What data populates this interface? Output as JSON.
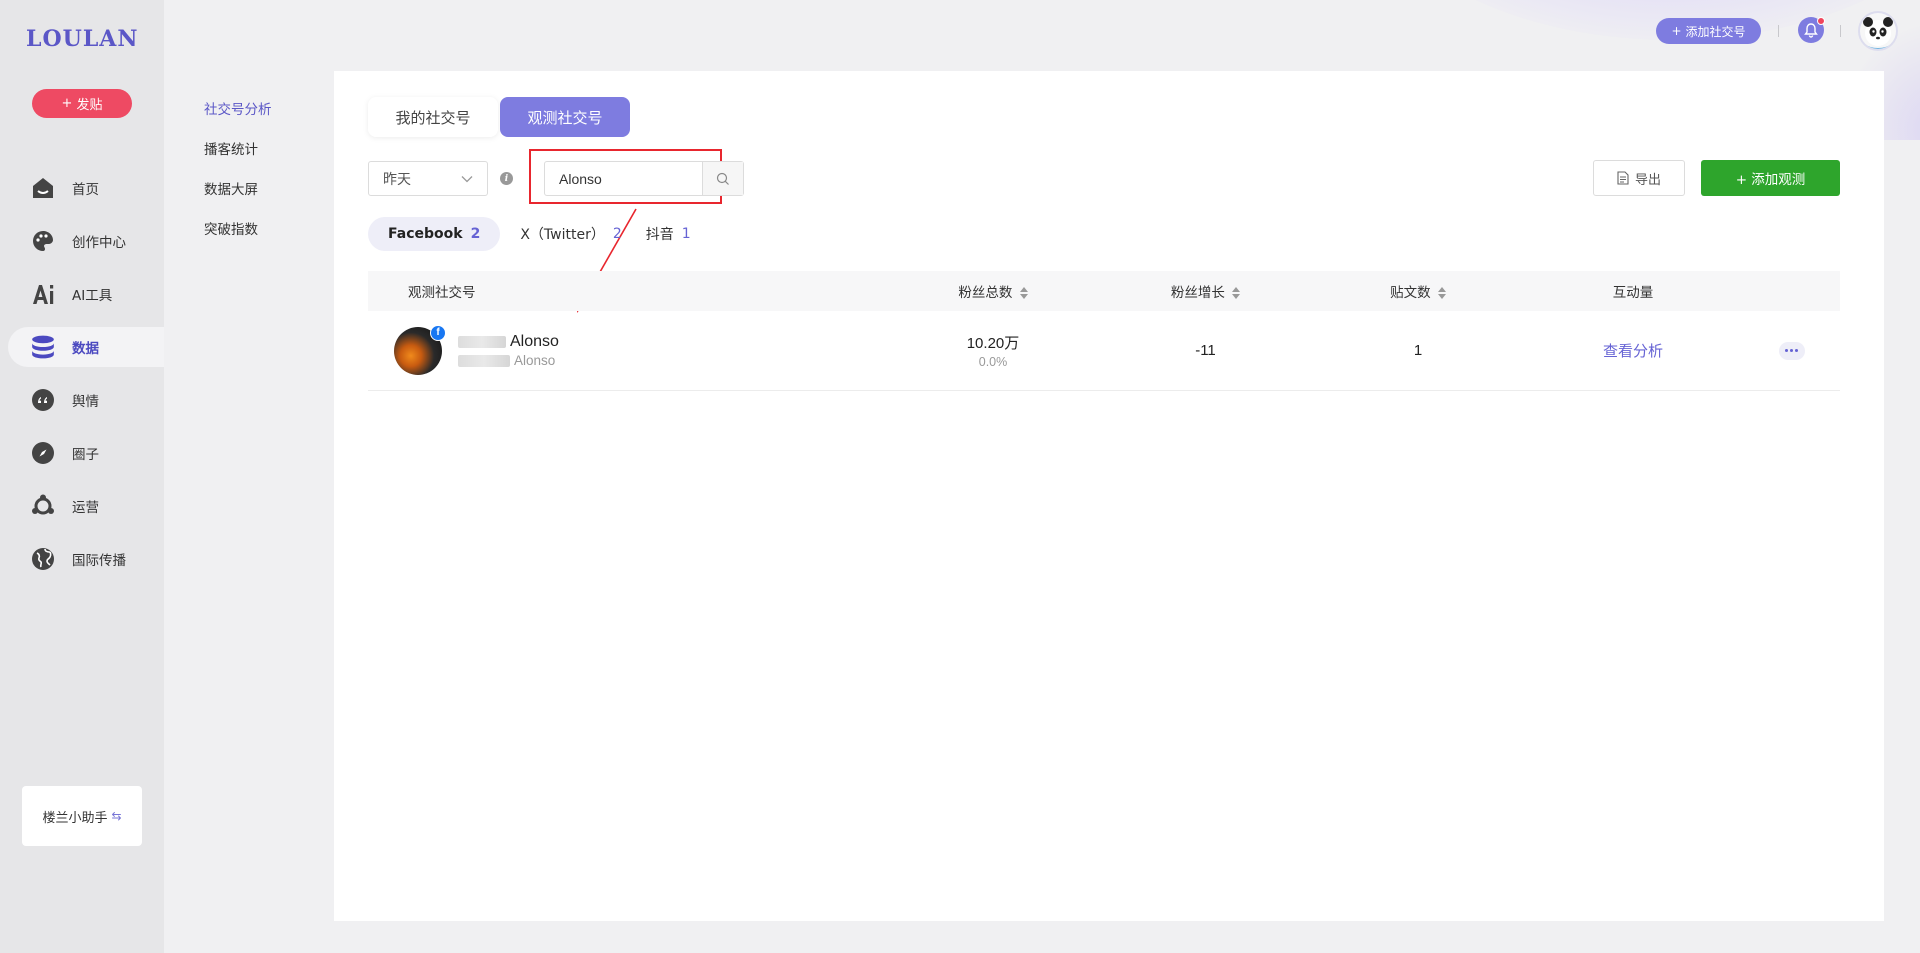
{
  "app": {
    "logo": "LOULAN",
    "post_button": "发贴"
  },
  "sidebar": {
    "items": [
      {
        "label": "首页",
        "icon": "home-icon"
      },
      {
        "label": "创作中心",
        "icon": "palette-icon"
      },
      {
        "label": "AI工具",
        "icon": "ai-icon"
      },
      {
        "label": "数据",
        "icon": "database-icon",
        "active": true
      },
      {
        "label": "舆情",
        "icon": "quote-icon"
      },
      {
        "label": "圈子",
        "icon": "compass-icon"
      },
      {
        "label": "运营",
        "icon": "network-icon"
      },
      {
        "label": "国际传播",
        "icon": "globe-icon"
      }
    ],
    "assistant": "楼兰小助手"
  },
  "subnav": {
    "items": [
      "社交号分析",
      "播客统计",
      "数据大屏",
      "突破指数"
    ],
    "active_index": 0
  },
  "header": {
    "add_account": "添加社交号"
  },
  "main": {
    "tabs": [
      "我的社交号",
      "观测社交号"
    ],
    "active_tab": 1,
    "date_select": "昨天",
    "search": {
      "value": "Alonso",
      "placeholder": ""
    },
    "export": "导出",
    "add_observe": "+ 添加观测",
    "platforms": [
      {
        "name": "Facebook",
        "count": "2",
        "active": true
      },
      {
        "name": "X（Twitter）",
        "count": "2"
      },
      {
        "name": "抖音",
        "count": "1"
      }
    ]
  },
  "table": {
    "headers": {
      "account": "观测社交号",
      "fans_total": "粉丝总数",
      "fans_growth": "粉丝增长",
      "posts": "贴文数",
      "interaction": "互动量"
    },
    "rows": [
      {
        "name": "Alonso",
        "handle": "Alonso",
        "platform": "facebook",
        "fans_total": "10.20万",
        "fans_rate": "0.0%",
        "fans_growth": "-11",
        "posts": "1",
        "interaction_link": "查看分析"
      }
    ]
  },
  "colors": {
    "brand": "#5b57c7",
    "accent": "#7e7ce0",
    "post_red": "#ee4a63",
    "add_green": "#2ea52c",
    "highlight_red": "#e8262e"
  }
}
